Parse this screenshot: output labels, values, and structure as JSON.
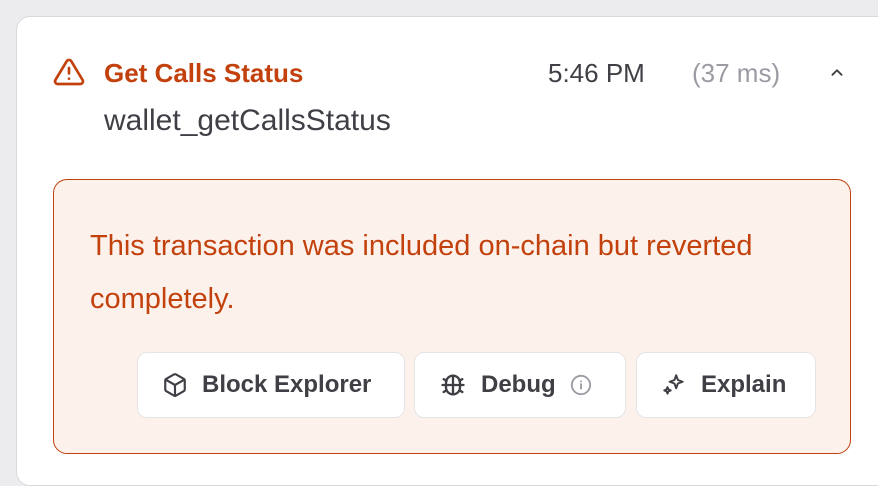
{
  "call": {
    "title": "Get Calls Status",
    "method": "wallet_getCallsStatus",
    "time": "5:46 PM",
    "duration": "(37 ms)"
  },
  "error": {
    "message": "This transaction was included on-chain but reverted completely."
  },
  "actions": {
    "block_explorer": "Block Explorer",
    "debug": "Debug",
    "explain": "Explain"
  },
  "colors": {
    "accent": "#c2410c",
    "error_bg": "#fdf1eb",
    "muted": "#9b9ba3"
  },
  "icons": {
    "status": "warning-triangle-icon",
    "collapse": "chevron-up-icon",
    "block_explorer": "cube-icon",
    "debug": "bug-icon",
    "debug_info": "info-circle-icon",
    "explain": "sparkles-icon"
  }
}
